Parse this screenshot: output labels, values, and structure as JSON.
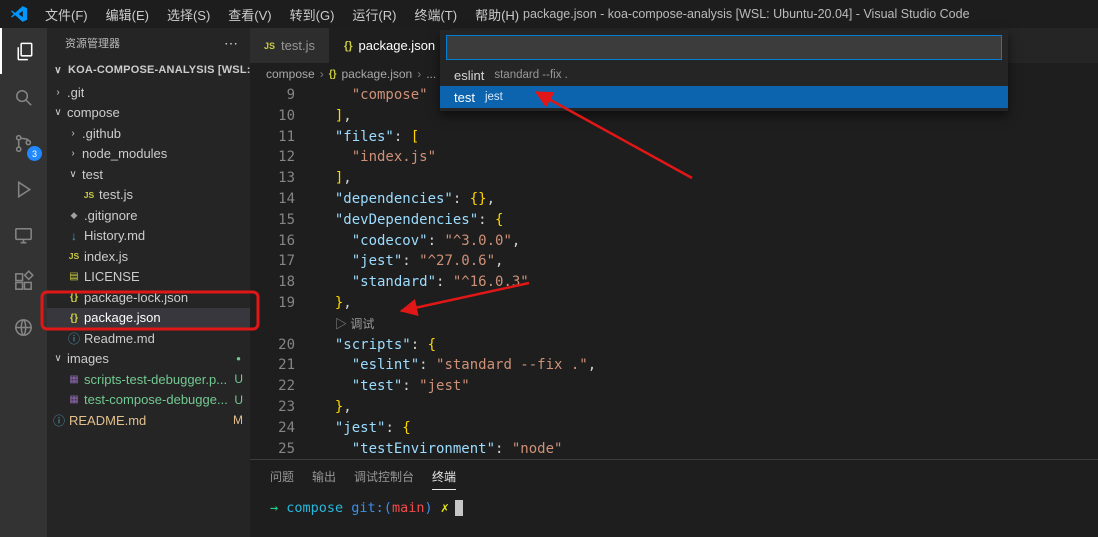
{
  "title_bar": {
    "menus": [
      "文件(F)",
      "编辑(E)",
      "选择(S)",
      "查看(V)",
      "转到(G)",
      "运行(R)",
      "终端(T)",
      "帮助(H)"
    ],
    "title": "package.json - koa-compose-analysis [WSL: Ubuntu-20.04] - Visual Studio Code"
  },
  "activity_bar": {
    "source_control_badge": "3"
  },
  "sidebar": {
    "header": "资源管理器",
    "more": "⋯",
    "section": {
      "chevron": "∨",
      "label": "KOA-COMPOSE-ANALYSIS [WSL: UB..."
    },
    "tree": [
      {
        "label": ".git",
        "depth": 1,
        "chevron": "›"
      },
      {
        "label": "compose",
        "depth": 1,
        "chevron": "∨"
      },
      {
        "label": ".github",
        "depth": 2,
        "chevron": "›"
      },
      {
        "label": "node_modules",
        "depth": 2,
        "chevron": "›"
      },
      {
        "label": "test",
        "depth": 2,
        "chevron": "∨"
      },
      {
        "label": "test.js",
        "depth": 3,
        "icon": "js-icon"
      },
      {
        "label": ".gitignore",
        "depth": 2,
        "icon": "git-icon"
      },
      {
        "label": "History.md",
        "depth": 2,
        "icon": "markdown-icon"
      },
      {
        "label": "index.js",
        "depth": 2,
        "icon": "js-icon"
      },
      {
        "label": "LICENSE",
        "depth": 2,
        "icon": "license-icon"
      },
      {
        "label": "package-lock.json",
        "depth": 2,
        "icon": "json-icon"
      },
      {
        "label": "package.json",
        "depth": 2,
        "icon": "json-icon",
        "selected": true
      },
      {
        "label": "Readme.md",
        "depth": 2,
        "icon": "info-icon"
      },
      {
        "label": "images",
        "depth": 1,
        "chevron": "∨",
        "dot": true
      },
      {
        "label": "scripts-test-debugger.p...",
        "depth": 2,
        "icon": "image-icon",
        "badge": "U",
        "color": "green"
      },
      {
        "label": "test-compose-debugge...",
        "depth": 2,
        "icon": "image-icon",
        "badge": "U",
        "color": "green"
      },
      {
        "label": "README.md",
        "depth": 1,
        "icon": "info-icon",
        "badge": "M",
        "color": "orange"
      }
    ]
  },
  "editor": {
    "tabs": [
      {
        "label": "test.js",
        "icon": "JS"
      },
      {
        "label": "package.json",
        "icon": "{}"
      }
    ],
    "breadcrumb": {
      "items": [
        "compose",
        "package.json",
        "..."
      ]
    },
    "code": {
      "lines": [
        {
          "n": "9",
          "segs": [
            {
              "t": "    ",
              "c": "punc"
            },
            {
              "t": "\"compose\"",
              "c": "str"
            }
          ]
        },
        {
          "n": "10",
          "segs": [
            {
              "t": "  ",
              "c": "punc"
            },
            {
              "t": "]",
              "c": "gold"
            },
            {
              "t": ",",
              "c": "punc"
            }
          ]
        },
        {
          "n": "11",
          "segs": [
            {
              "t": "  ",
              "c": "punc"
            },
            {
              "t": "\"files\"",
              "c": "key"
            },
            {
              "t": ": ",
              "c": "punc"
            },
            {
              "t": "[",
              "c": "gold"
            }
          ]
        },
        {
          "n": "12",
          "segs": [
            {
              "t": "    ",
              "c": "punc"
            },
            {
              "t": "\"index.js\"",
              "c": "str"
            }
          ]
        },
        {
          "n": "13",
          "segs": [
            {
              "t": "  ",
              "c": "punc"
            },
            {
              "t": "]",
              "c": "gold"
            },
            {
              "t": ",",
              "c": "punc"
            }
          ]
        },
        {
          "n": "14",
          "segs": [
            {
              "t": "  ",
              "c": "punc"
            },
            {
              "t": "\"dependencies\"",
              "c": "key"
            },
            {
              "t": ": ",
              "c": "punc"
            },
            {
              "t": "{}",
              "c": "gold"
            },
            {
              "t": ",",
              "c": "punc"
            }
          ]
        },
        {
          "n": "15",
          "segs": [
            {
              "t": "  ",
              "c": "punc"
            },
            {
              "t": "\"devDependencies\"",
              "c": "key"
            },
            {
              "t": ": ",
              "c": "punc"
            },
            {
              "t": "{",
              "c": "gold"
            }
          ]
        },
        {
          "n": "16",
          "segs": [
            {
              "t": "    ",
              "c": "punc"
            },
            {
              "t": "\"codecov\"",
              "c": "key"
            },
            {
              "t": ": ",
              "c": "punc"
            },
            {
              "t": "\"^3.0.0\"",
              "c": "str"
            },
            {
              "t": ",",
              "c": "punc"
            }
          ]
        },
        {
          "n": "17",
          "segs": [
            {
              "t": "    ",
              "c": "punc"
            },
            {
              "t": "\"jest\"",
              "c": "key"
            },
            {
              "t": ": ",
              "c": "punc"
            },
            {
              "t": "\"^27.0.6\"",
              "c": "str"
            },
            {
              "t": ",",
              "c": "punc"
            }
          ]
        },
        {
          "n": "18",
          "segs": [
            {
              "t": "    ",
              "c": "punc"
            },
            {
              "t": "\"standard\"",
              "c": "key"
            },
            {
              "t": ": ",
              "c": "punc"
            },
            {
              "t": "\"^16.0.3\"",
              "c": "str"
            }
          ]
        },
        {
          "n": "19",
          "segs": [
            {
              "t": "  ",
              "c": "punc"
            },
            {
              "t": "}",
              "c": "gold"
            },
            {
              "t": ",",
              "c": "punc"
            }
          ]
        },
        {
          "lens": true,
          "segs": [
            {
              "t": "▷ 调试",
              "c": "lens"
            }
          ]
        },
        {
          "n": "20",
          "segs": [
            {
              "t": "  ",
              "c": "punc"
            },
            {
              "t": "\"scripts\"",
              "c": "key"
            },
            {
              "t": ": ",
              "c": "punc"
            },
            {
              "t": "{",
              "c": "gold"
            }
          ]
        },
        {
          "n": "21",
          "segs": [
            {
              "t": "    ",
              "c": "punc"
            },
            {
              "t": "\"eslint\"",
              "c": "key"
            },
            {
              "t": ": ",
              "c": "punc"
            },
            {
              "t": "\"standard --fix .\"",
              "c": "str"
            },
            {
              "t": ",",
              "c": "punc"
            }
          ]
        },
        {
          "n": "22",
          "segs": [
            {
              "t": "    ",
              "c": "punc"
            },
            {
              "t": "\"test\"",
              "c": "key"
            },
            {
              "t": ": ",
              "c": "punc"
            },
            {
              "t": "\"jest\"",
              "c": "str"
            }
          ]
        },
        {
          "n": "23",
          "segs": [
            {
              "t": "  ",
              "c": "punc"
            },
            {
              "t": "}",
              "c": "gold"
            },
            {
              "t": ",",
              "c": "punc"
            }
          ]
        },
        {
          "n": "24",
          "segs": [
            {
              "t": "  ",
              "c": "punc"
            },
            {
              "t": "\"jest\"",
              "c": "key"
            },
            {
              "t": ": ",
              "c": "punc"
            },
            {
              "t": "{",
              "c": "gold"
            }
          ]
        },
        {
          "n": "25",
          "segs": [
            {
              "t": "    ",
              "c": "punc"
            },
            {
              "t": "\"testEnvironment\"",
              "c": "key"
            },
            {
              "t": ": ",
              "c": "punc"
            },
            {
              "t": "\"node\"",
              "c": "str"
            }
          ]
        }
      ]
    }
  },
  "quick_input": {
    "value": "",
    "items": [
      {
        "label": "eslint",
        "desc": "standard --fix ."
      },
      {
        "label": "test",
        "desc": "jest",
        "active": true
      }
    ]
  },
  "panel": {
    "tabs": [
      {
        "label": "问题"
      },
      {
        "label": "输出"
      },
      {
        "label": "调试控制台"
      },
      {
        "label": "终端",
        "active": true
      }
    ],
    "terminal": {
      "segments": [
        {
          "t": "→",
          "c": "green"
        },
        {
          "t": " compose",
          "c": "cyan"
        },
        {
          "t": " git:(",
          "c": "blue"
        },
        {
          "t": "main",
          "c": "red"
        },
        {
          "t": ")",
          "c": "blue"
        },
        {
          "t": " ✗",
          "c": "yellow"
        }
      ]
    }
  },
  "annotations": {
    "color": "#e11717"
  }
}
